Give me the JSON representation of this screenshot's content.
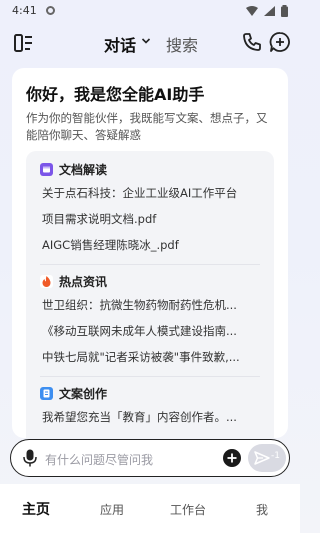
{
  "status": {
    "time": "4:41"
  },
  "header": {
    "chat_tab": "对话",
    "search_tab": "搜索"
  },
  "card": {
    "greeting": "你好，我是您全能AI助手",
    "intro": "作为你的智能伙伴，我既能写文案、想点子，又能陪你聊天、答疑解惑"
  },
  "sections": [
    {
      "title": "文档解读",
      "icon": "document-icon",
      "color": "#7b55e8",
      "items": [
        "关于点石科技：企业工业级AI工作平台",
        "项目需求说明文档.pdf",
        "AIGC销售经理陈晓冰_.pdf"
      ]
    },
    {
      "title": "热点资讯",
      "icon": "fire-icon",
      "color": "#f05a28",
      "items": [
        "世卫组织：抗微生物药物耐药性危机...",
        "《移动互联网未成年人模式建设指南...",
        "中铁七局就\"记者采访被袭\"事件致歉,..."
      ]
    },
    {
      "title": "文案创作",
      "icon": "copywriting-icon",
      "color": "#3d8ef0",
      "items": [
        "我希望您充当「教育」内容创作者。..."
      ]
    }
  ],
  "input": {
    "placeholder": "有什么问题尽管问我",
    "send_count": "-1"
  },
  "nav": {
    "items": [
      "主页",
      "应用",
      "工作台",
      "我"
    ],
    "active": "主页"
  }
}
